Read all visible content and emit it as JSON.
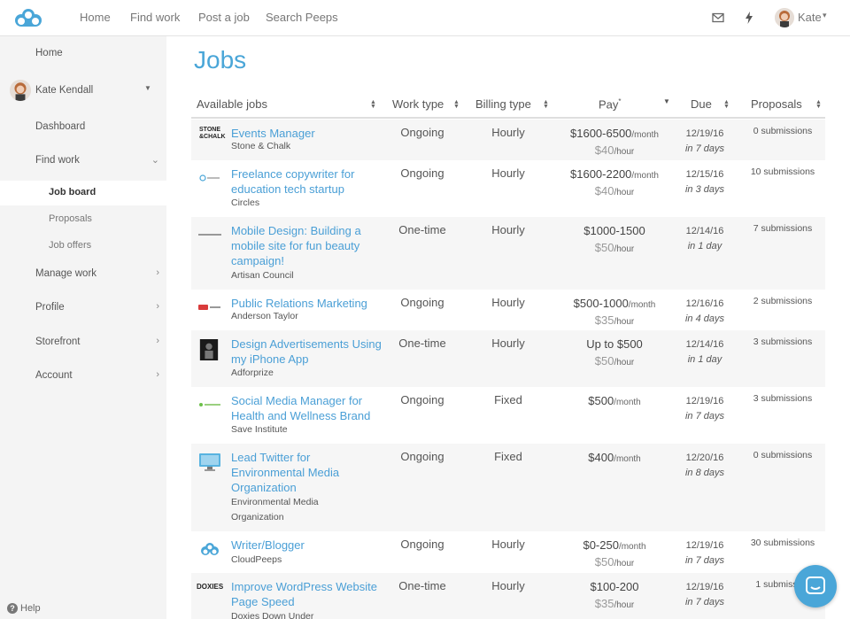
{
  "topbar": {
    "nav": [
      "Home",
      "Find work",
      "Post a job",
      "Search Peeps"
    ],
    "user": "Kate",
    "icons": [
      "cloudpeeps-logo-icon",
      "mail-icon",
      "lightning-icon",
      "avatar",
      "caret-down-icon"
    ]
  },
  "sidebar": {
    "home": "Home",
    "profile_name": "Kate Kendall",
    "dashboard": "Dashboard",
    "find_work": "Find work",
    "sub": [
      "Job board",
      "Proposals",
      "Job offers"
    ],
    "manage_work": "Manage work",
    "profile": "Profile",
    "storefront": "Storefront",
    "account": "Account",
    "help": "Help"
  },
  "page": {
    "title": "Jobs"
  },
  "table": {
    "headers": {
      "available": "Available jobs",
      "work": "Work type",
      "billing": "Billing type",
      "pay": "Pay",
      "pay_mark": "*",
      "due": "Due",
      "proposals": "Proposals"
    },
    "rows": [
      {
        "title": "Events Manager",
        "company": "Stone & Chalk",
        "work": "Ongoing",
        "billing": "Hourly",
        "pay": "$1600-6500",
        "pay_unit": "/month",
        "rate": "$40",
        "rate_unit": "/hour",
        "due": "12/19/16",
        "due_rel": "in 7 days",
        "proposals": "0 submissions",
        "logo": "STONE & CHALK"
      },
      {
        "title": "Freelance copywriter for education tech startup",
        "company": "Circles",
        "work": "Ongoing",
        "billing": "Hourly",
        "pay": "$1600-2200",
        "pay_unit": "/month",
        "rate": "$40",
        "rate_unit": "/hour",
        "due": "12/15/16",
        "due_rel": "in 3 days",
        "proposals": "10 submissions",
        "logo": "circles"
      },
      {
        "title": "Mobile Design: Building a mobile site for fun beauty campaign!",
        "company": "Artisan Council",
        "work": "One-time",
        "billing": "Hourly",
        "pay": "$1000-1500",
        "pay_unit": "",
        "rate": "$50",
        "rate_unit": "/hour",
        "due": "12/14/16",
        "due_rel": "in 1 day",
        "proposals": "7 submissions",
        "logo": "artisan council"
      },
      {
        "title": "Public Relations Marketing",
        "company": "Anderson Taylor",
        "work": "Ongoing",
        "billing": "Hourly",
        "pay": "$500-1000",
        "pay_unit": "/month",
        "rate": "$35",
        "rate_unit": "/hour",
        "due": "12/16/16",
        "due_rel": "in 4 days",
        "proposals": "2 submissions",
        "logo": "anderson"
      },
      {
        "title": "Design Advertisements Using my iPhone App",
        "company": "Adforprize",
        "work": "One-time",
        "billing": "Hourly",
        "pay": "Up to $500",
        "pay_unit": "",
        "rate": "$50",
        "rate_unit": "/hour",
        "due": "12/14/16",
        "due_rel": "in 1 day",
        "proposals": "3 submissions",
        "logo": "adforprize"
      },
      {
        "title": "Social Media Manager for Health and Wellness Brand",
        "company": "Save Institute",
        "work": "Ongoing",
        "billing": "Fixed",
        "pay": "$500",
        "pay_unit": "/month",
        "rate": "",
        "rate_unit": "",
        "due": "12/19/16",
        "due_rel": "in 7 days",
        "proposals": "3 submissions",
        "logo": "save institute"
      },
      {
        "title": "Lead Twitter for Environmental Media Organization",
        "company": "Environmental Media Organization",
        "work": "Ongoing",
        "billing": "Fixed",
        "pay": "$400",
        "pay_unit": "/month",
        "rate": "",
        "rate_unit": "",
        "due": "12/20/16",
        "due_rel": "in 8 days",
        "proposals": "0 submissions",
        "logo": "monitor"
      },
      {
        "title": "Writer/Blogger",
        "company": "CloudPeeps",
        "work": "Ongoing",
        "billing": "Hourly",
        "pay": "$0-250",
        "pay_unit": "/month",
        "rate": "$50",
        "rate_unit": "/hour",
        "due": "12/19/16",
        "due_rel": "in 7 days",
        "proposals": "30 submissions",
        "logo": "cloudpeeps"
      },
      {
        "title": "Improve WordPress Website Page Speed",
        "company": "Doxies Down Under",
        "work": "One-time",
        "billing": "Hourly",
        "pay": "$100-200",
        "pay_unit": "",
        "rate": "$35",
        "rate_unit": "/hour",
        "due": "12/19/16",
        "due_rel": "in 7 days",
        "proposals": "1 submission",
        "logo": "DOXIES"
      }
    ]
  },
  "colors": {
    "accent": "#4aa6d8",
    "sidebar_bg": "#f4f4f4",
    "row_alt": "#f6f6f6"
  }
}
